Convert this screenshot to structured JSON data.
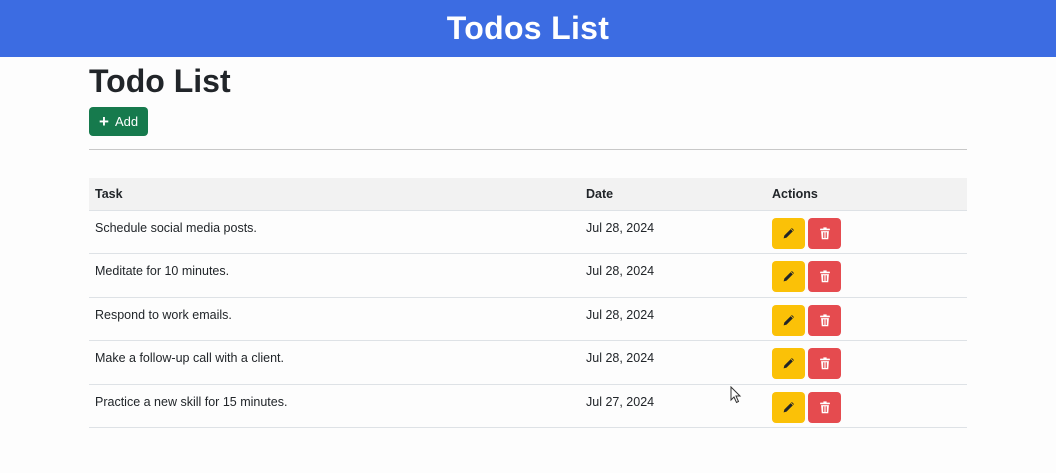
{
  "header": {
    "title": "Todos List"
  },
  "main": {
    "title": "Todo List",
    "add_label": "Add"
  },
  "table": {
    "columns": {
      "task": "Task",
      "date": "Date",
      "actions": "Actions"
    },
    "rows": [
      {
        "task": "Schedule social media posts.",
        "date": "Jul 28, 2024"
      },
      {
        "task": "Meditate for 10 minutes.",
        "date": "Jul 28, 2024"
      },
      {
        "task": "Respond to work emails.",
        "date": "Jul 28, 2024"
      },
      {
        "task": "Make a follow-up call with a client.",
        "date": "Jul 28, 2024"
      },
      {
        "task": "Practice a new skill for 15 minutes.",
        "date": "Jul 27, 2024"
      }
    ]
  },
  "icons": {
    "add": "plus-icon",
    "edit": "pencil-icon",
    "delete": "trash-icon"
  },
  "colors": {
    "header_bg": "#3c6ce2",
    "add_button": "#167a4d",
    "edit_button": "#fbc107",
    "delete_button": "#e54b4f"
  }
}
